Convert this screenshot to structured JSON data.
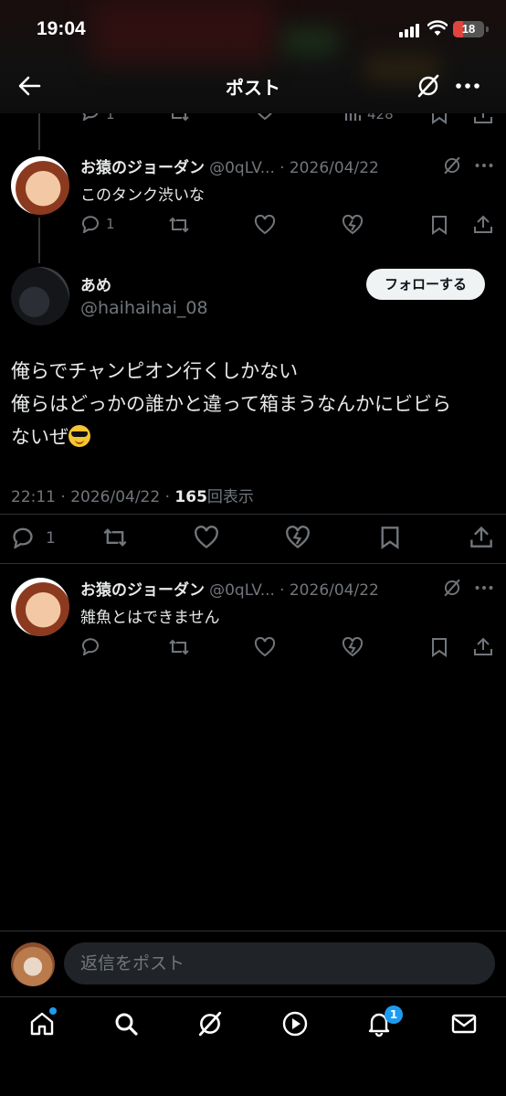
{
  "status": {
    "time": "19:04",
    "battery": "18"
  },
  "header": {
    "title": "ポスト"
  },
  "peek": {
    "reply_count": "1",
    "views": "428"
  },
  "reply1": {
    "name": "お猿のジョーダン",
    "handle": "@0qLV...",
    "date": "· 2026/04/22",
    "text": "このタンク渋いな",
    "reply_count": "1"
  },
  "main_post": {
    "name": "あめ",
    "handle": "@haihaihai_08",
    "follow_label": "フォローする",
    "line1": "俺らでチャンピオン行くしかない",
    "line2": "俺らはどっかの誰かと違って箱まうなんかにビビら",
    "line3": "ないぜ",
    "timestamp": "22:11 · 2026/04/22 · ",
    "views": "165",
    "views_label": "回表示",
    "reply_count": "1"
  },
  "reply2": {
    "name": "お猿のジョーダン",
    "handle": "@0qLV...",
    "date": "· 2026/04/22",
    "text": "雑魚とはできません"
  },
  "reply_bar": {
    "placeholder": "返信をポスト"
  },
  "tabbar": {
    "notifications_badge": "1"
  },
  "colors": {
    "accent": "#1d9bf0",
    "muted": "#71767b",
    "text": "#e7e9ea",
    "background": "#000000"
  }
}
